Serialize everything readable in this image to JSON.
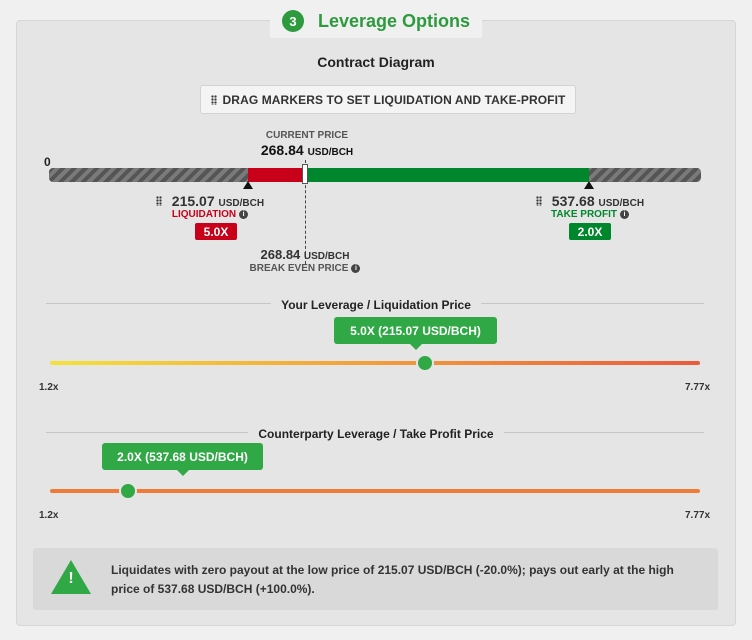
{
  "section": {
    "step": "3",
    "title": "Leverage Options"
  },
  "diagram": {
    "title": "Contract Diagram",
    "drag_hint": "DRAG MARKERS TO SET LIQUIDATION AND TAKE-PROFIT",
    "zero_label": "0",
    "current_price": {
      "label": "CURRENT PRICE",
      "value": "268.84",
      "unit": "USD/BCH"
    },
    "liquidation": {
      "value": "215.07",
      "unit": "USD/BCH",
      "label": "LIQUIDATION",
      "badge": "5.0X"
    },
    "take_profit": {
      "value": "537.68",
      "unit": "USD/BCH",
      "label": "TAKE PROFIT",
      "badge": "2.0X"
    },
    "break_even": {
      "value": "268.84",
      "unit": "USD/BCH",
      "label": "BREAK EVEN PRICE"
    }
  },
  "your_leverage": {
    "title": "Your Leverage / Liquidation Price",
    "tooltip": "5.0X (215.07 USD/BCH)",
    "min_label": "1.2x",
    "max_label": "7.77x",
    "value": 5.0
  },
  "counterparty_leverage": {
    "title": "Counterparty Leverage / Take Profit Price",
    "tooltip": "2.0X (537.68 USD/BCH)",
    "min_label": "1.2x",
    "max_label": "7.77x",
    "value": 2.0
  },
  "notice": {
    "icon": "warning-icon",
    "text": "Liquidates with zero payout at the low price of 215.07 USD/BCH (-20.0%); pays out early at the high price of 537.68 USD/BCH (+100.0%)."
  },
  "colors": {
    "accent_green": "#2fa845",
    "liquidation_red": "#c8001a",
    "take_profit_green": "#00872e"
  }
}
